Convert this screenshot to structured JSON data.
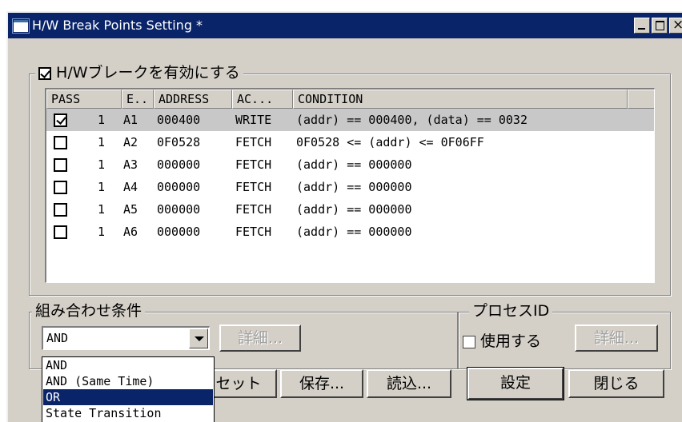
{
  "window": {
    "title": "H/W Break Points Setting *"
  },
  "hw_group": {
    "enable_label": "H/Wブレークを有効にする",
    "enabled": true
  },
  "list": {
    "columns": [
      "PASS",
      "E..",
      "ADDRESS",
      "AC...",
      "CONDITION"
    ],
    "rows": [
      {
        "checked": true,
        "pass": "1",
        "event": "A1",
        "address": "000400",
        "access": "WRITE",
        "condition": "(addr) == 000400, (data) == 0032"
      },
      {
        "checked": false,
        "pass": "1",
        "event": "A2",
        "address": "0F0528",
        "access": "FETCH",
        "condition": "0F0528 <= (addr) <= 0F06FF"
      },
      {
        "checked": false,
        "pass": "1",
        "event": "A3",
        "address": "000000",
        "access": "FETCH",
        "condition": "(addr) == 000000"
      },
      {
        "checked": false,
        "pass": "1",
        "event": "A4",
        "address": "000000",
        "access": "FETCH",
        "condition": "(addr) == 000000"
      },
      {
        "checked": false,
        "pass": "1",
        "event": "A5",
        "address": "000000",
        "access": "FETCH",
        "condition": "(addr) == 000000"
      },
      {
        "checked": false,
        "pass": "1",
        "event": "A6",
        "address": "000000",
        "access": "FETCH",
        "condition": "(addr) == 000000"
      }
    ]
  },
  "combination": {
    "title": "組み合わせ条件",
    "selected": "AND",
    "detail_label": "詳細...",
    "options": [
      "AND",
      "AND (Same Time)",
      "OR",
      "State Transition"
    ],
    "highlighted": "OR"
  },
  "process": {
    "title": "プロセスID",
    "use_label": "使用する",
    "use_checked": false,
    "detail_label": "詳細..."
  },
  "buttons": {
    "reset": "セット",
    "save": "保存...",
    "load": "読込...",
    "set": "設定",
    "close": "閉じる"
  }
}
